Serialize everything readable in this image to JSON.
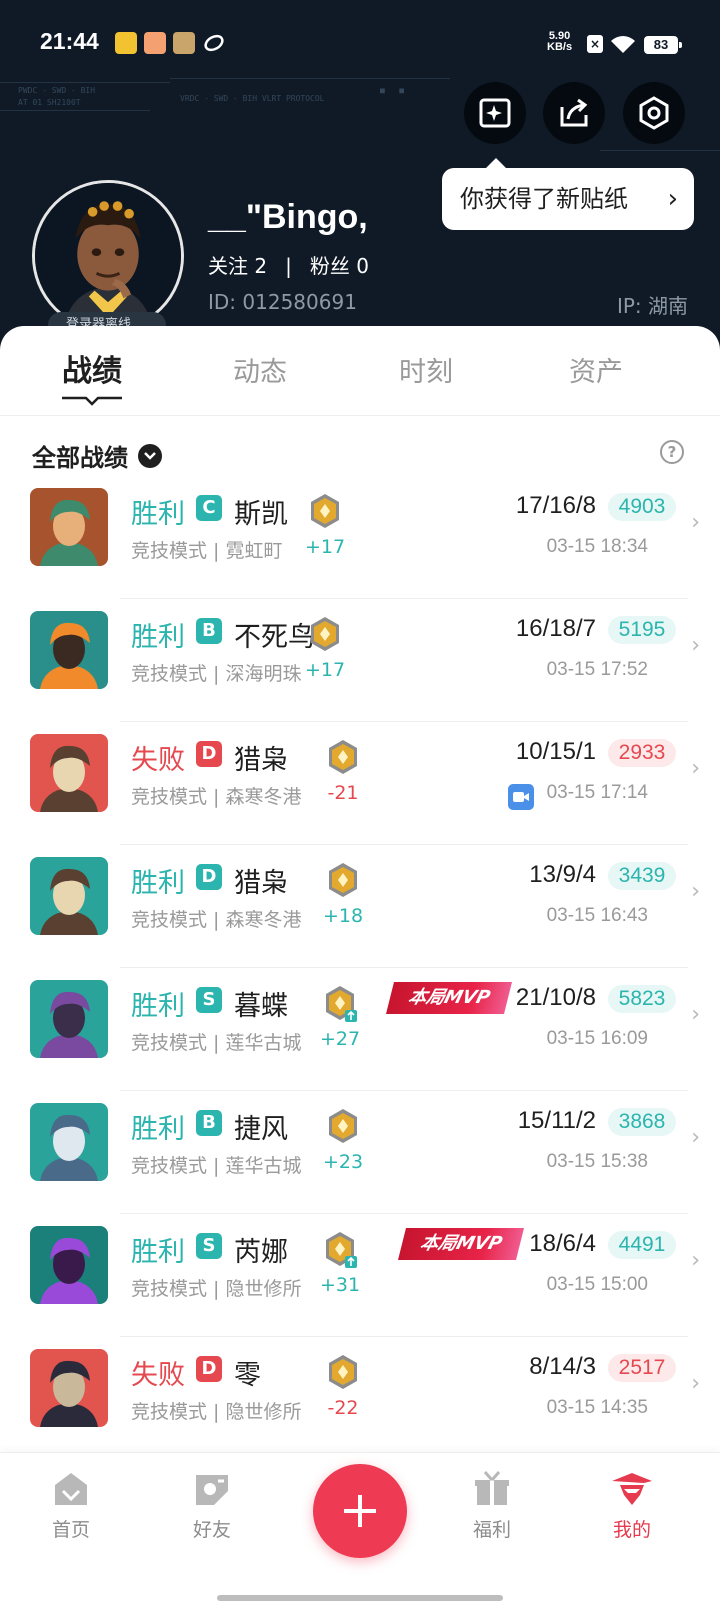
{
  "status_bar": {
    "time": "21:44",
    "net_speed": "5.90",
    "net_unit": "KB/s",
    "battery": "83"
  },
  "header": {
    "username": "__\"Bingo,",
    "following_label": "关注",
    "following_count": "2",
    "followers_label": "粉丝",
    "followers_count": "0",
    "id_label": "ID:",
    "id_value": "012580691",
    "ip_label": "IP:",
    "ip_value": "湖南",
    "avatar_badge": "登录器离线",
    "tooltip": "你获得了新贴纸",
    "buttons": [
      "sticker-icon",
      "share-icon",
      "settings-icon"
    ]
  },
  "tabs": [
    {
      "label": "战绩",
      "active": true
    },
    {
      "label": "动态",
      "active": false
    },
    {
      "label": "时刻",
      "active": false
    },
    {
      "label": "资产",
      "active": false
    }
  ],
  "section": {
    "title": "全部战绩"
  },
  "matches": [
    {
      "result": "胜利",
      "win": true,
      "grade": "C",
      "agent": "斯凯",
      "mode": "竞技模式",
      "map": "霓虹町",
      "rank_delta": "+17",
      "kda": "17/16/8",
      "score": "4903",
      "time": "03-15 18:34",
      "mvp": false,
      "video": false
    },
    {
      "result": "胜利",
      "win": true,
      "grade": "B",
      "agent": "不死鸟",
      "mode": "竞技模式",
      "map": "深海明珠",
      "rank_delta": "+17",
      "kda": "16/18/7",
      "score": "5195",
      "time": "03-15 17:52",
      "mvp": false,
      "video": false
    },
    {
      "result": "失败",
      "win": false,
      "grade": "D",
      "agent": "猎枭",
      "mode": "竞技模式",
      "map": "森寒冬港",
      "rank_delta": "-21",
      "kda": "10/15/1",
      "score": "2933",
      "time": "03-15 17:14",
      "mvp": false,
      "video": true
    },
    {
      "result": "胜利",
      "win": true,
      "grade": "D",
      "agent": "猎枭",
      "mode": "竞技模式",
      "map": "森寒冬港",
      "rank_delta": "+18",
      "kda": "13/9/4",
      "score": "3439",
      "time": "03-15 16:43",
      "mvp": false,
      "video": false
    },
    {
      "result": "胜利",
      "win": true,
      "grade": "S",
      "agent": "暮蝶",
      "mode": "竞技模式",
      "map": "莲华古城",
      "rank_delta": "+27",
      "kda": "21/10/8",
      "score": "5823",
      "time": "03-15 16:09",
      "mvp": true,
      "video": false
    },
    {
      "result": "胜利",
      "win": true,
      "grade": "B",
      "agent": "捷风",
      "mode": "竞技模式",
      "map": "莲华古城",
      "rank_delta": "+23",
      "kda": "15/11/2",
      "score": "3868",
      "time": "03-15 15:38",
      "mvp": false,
      "video": false
    },
    {
      "result": "胜利",
      "win": true,
      "grade": "S",
      "agent": "芮娜",
      "mode": "竞技模式",
      "map": "隐世修所",
      "rank_delta": "+31",
      "kda": "18/6/4",
      "score": "4491",
      "time": "03-15 15:00",
      "mvp": true,
      "video": false
    },
    {
      "result": "失败",
      "win": false,
      "grade": "D",
      "agent": "零",
      "mode": "竞技模式",
      "map": "隐世修所",
      "rank_delta": "-22",
      "kda": "8/14/3",
      "score": "2517",
      "time": "03-15 14:35",
      "mvp": false,
      "video": false
    }
  ],
  "mvp_label": "本局MVP",
  "nav": [
    {
      "label": "首页",
      "icon": "home-icon",
      "active": false
    },
    {
      "label": "好友",
      "icon": "friends-icon",
      "active": false
    },
    {
      "label": "福利",
      "icon": "gift-icon",
      "active": false
    },
    {
      "label": "我的",
      "icon": "profile-icon",
      "active": true
    }
  ],
  "colors": {
    "win": "#2bb5ae",
    "loss": "#e5494f",
    "accent": "#ee3a52",
    "header_bg": "#0f1a26"
  }
}
